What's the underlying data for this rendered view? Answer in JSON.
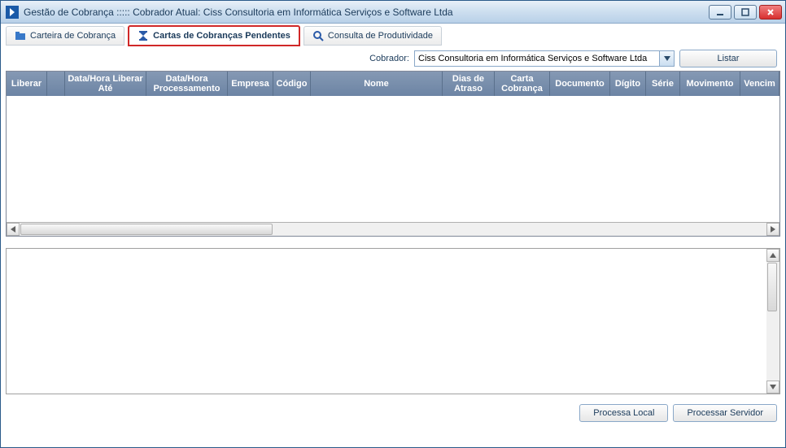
{
  "window": {
    "title": "Gestão de Cobrança ::::: Cobrador Atual:  Ciss Consultoria em Informática Serviços e Software Ltda"
  },
  "tabs": [
    {
      "label": "Carteira de Cobrança",
      "icon": "folder-icon"
    },
    {
      "label": "Cartas de Cobranças Pendentes",
      "icon": "hourglass-icon"
    },
    {
      "label": "Consulta de Produtividade",
      "icon": "search-icon"
    }
  ],
  "filter": {
    "label": "Cobrador:",
    "value": "Ciss Consultoria em Informática Serviços e Software Ltda",
    "listar": "Listar"
  },
  "columns": [
    "Liberar",
    "",
    "Data/Hora Liberar Até",
    "Data/Hora Processamento",
    "Empresa",
    "Código",
    "Nome",
    "Dias de Atraso",
    "Carta Cobrança",
    "Documento",
    "Dígito",
    "Série",
    "Movimento",
    "Vencim"
  ],
  "footer": {
    "processa_local": "Processa Local",
    "processar_servidor": "Processar Servidor"
  }
}
